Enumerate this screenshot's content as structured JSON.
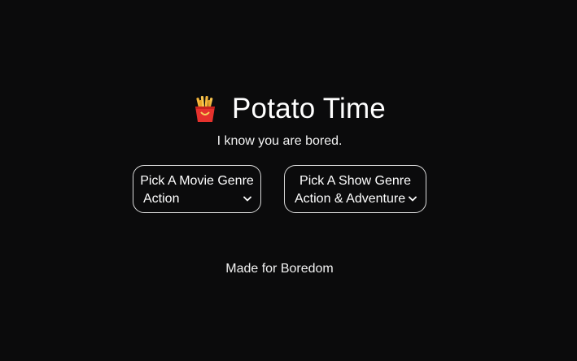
{
  "header": {
    "icon": "french-fries-icon",
    "title": "Potato Time",
    "subtitle": "I know you are bored."
  },
  "movie_picker": {
    "label": "Pick A Movie Genre",
    "selected": "Action"
  },
  "show_picker": {
    "label": "Pick A Show Genre",
    "selected": "Action & Adventure"
  },
  "footer": {
    "text": "Made for Boredom"
  },
  "colors": {
    "background": "#0b0b0c",
    "text": "#ffffff",
    "border": "#d9d9d9",
    "fries_box": "#e5322d",
    "fries": "#f6b73c"
  }
}
